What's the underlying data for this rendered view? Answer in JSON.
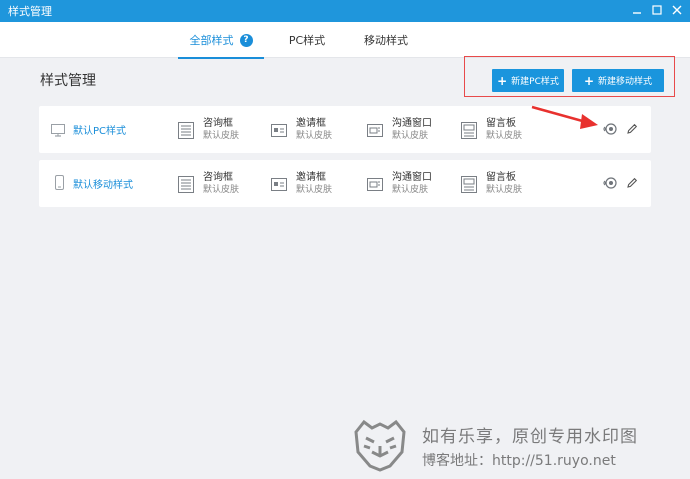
{
  "window": {
    "title": "样式管理",
    "controls": [
      "minimize",
      "maximize",
      "close"
    ]
  },
  "tabs": [
    {
      "label": "全部样式",
      "active": true,
      "has_help": true,
      "help_glyph": "?"
    },
    {
      "label": "PC样式",
      "active": false
    },
    {
      "label": "移动样式",
      "active": false
    }
  ],
  "page": {
    "title": "样式管理"
  },
  "buttons": {
    "new_pc": "新建PC样式",
    "new_mobile": "新建移动样式",
    "plus": "+"
  },
  "styles": [
    {
      "name": "默认PC样式",
      "type_icon": "monitor-icon",
      "widgets": [
        {
          "title": "咨询框",
          "sub": "默认皮肤",
          "icon": "consult-box-icon"
        },
        {
          "title": "邀请框",
          "sub": "默认皮肤",
          "icon": "invite-box-icon"
        },
        {
          "title": "沟通窗口",
          "sub": "默认皮肤",
          "icon": "chat-window-icon"
        },
        {
          "title": "留言板",
          "sub": "默认皮肤",
          "icon": "message-board-icon"
        }
      ]
    },
    {
      "name": "默认移动样式",
      "type_icon": "mobile-icon",
      "widgets": [
        {
          "title": "咨询框",
          "sub": "默认皮肤",
          "icon": "consult-box-icon"
        },
        {
          "title": "邀请框",
          "sub": "默认皮肤",
          "icon": "invite-box-icon"
        },
        {
          "title": "沟通窗口",
          "sub": "默认皮肤",
          "icon": "chat-window-icon"
        },
        {
          "title": "留言板",
          "sub": "默认皮肤",
          "icon": "message-board-icon"
        }
      ]
    }
  ],
  "watermark": {
    "line1": "如有乐享，原创专用水印图",
    "line2": "博客地址：http://51.ruyo.net"
  },
  "colors": {
    "accent": "#1a95dd",
    "titlebar": "#1f96dc",
    "highlight": "#e84a4a",
    "background": "#f0f1f4"
  }
}
